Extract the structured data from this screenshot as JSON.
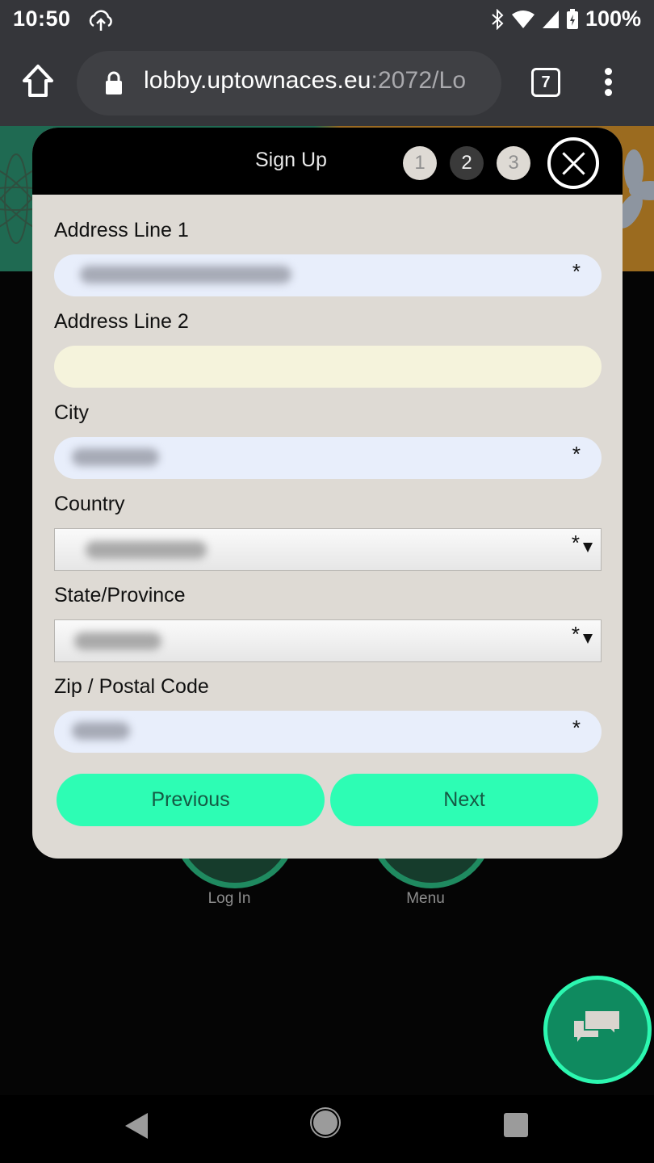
{
  "status_bar": {
    "time": "10:50",
    "battery": "100%",
    "icons": [
      "cloud-upload-icon",
      "bluetooth-icon",
      "wifi-icon",
      "signal-icon",
      "battery-charging-icon"
    ]
  },
  "browser": {
    "url_host": "lobby.uptownaces.eu",
    "url_rest": ":2072/Lo",
    "tab_count": "7"
  },
  "modal": {
    "title": "Sign Up",
    "steps": [
      {
        "label": "1",
        "state": "done"
      },
      {
        "label": "2",
        "state": "active"
      },
      {
        "label": "3",
        "state": "pending"
      }
    ],
    "fields": [
      {
        "label": "Address Line 1",
        "type": "text",
        "value": "(blurred)",
        "required": "*"
      },
      {
        "label": "Address Line 2",
        "type": "text",
        "value": "",
        "required": ""
      },
      {
        "label": "City",
        "type": "text",
        "value": "(blurred)",
        "required": "*"
      },
      {
        "label": "Country",
        "type": "select",
        "value": "(blurred)",
        "required": "*"
      },
      {
        "label": "State/Province",
        "type": "select",
        "value": "(blurred)",
        "required": "*"
      },
      {
        "label": "Zip / Postal Code",
        "type": "text",
        "value": "(blurred)",
        "required": "*"
      }
    ],
    "previous_label": "Previous",
    "next_label": "Next"
  },
  "background_page": {
    "login_label": "Log In",
    "menu_label": "Menu"
  },
  "colors": {
    "accent": "#2dfdb4",
    "chat_fab": "#0f8a5f",
    "modal_bg": "#dedad4"
  }
}
